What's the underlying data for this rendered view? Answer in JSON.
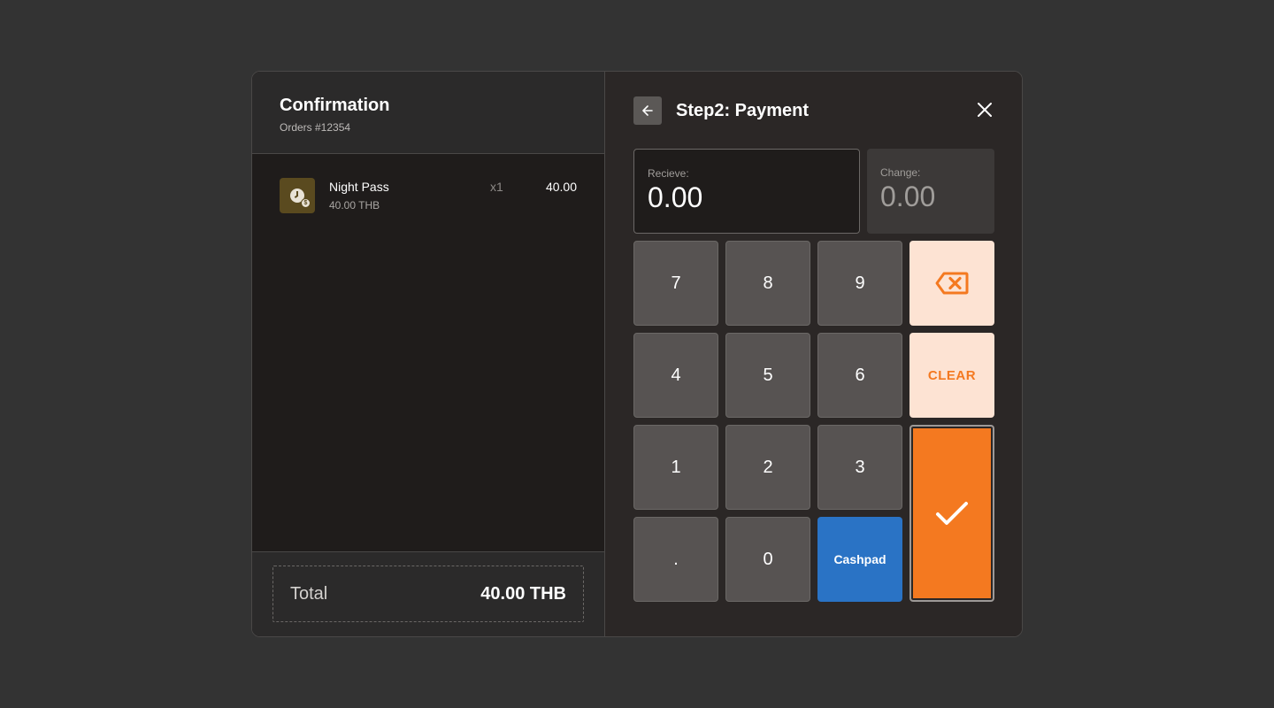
{
  "left": {
    "title": "Confirmation",
    "order": "Orders #12354",
    "items": [
      {
        "name": "Night Pass",
        "unit_price": "40.00 THB",
        "qty": "x1",
        "total": "40.00",
        "icon": "night-pass-clock-coin-icon"
      }
    ],
    "footer": {
      "label": "Total",
      "value": "40.00 THB"
    }
  },
  "right": {
    "title": "Step2: Payment",
    "receive": {
      "label": "Recieve:",
      "value": "0.00"
    },
    "change": {
      "label": "Change:",
      "value": "0.00"
    },
    "keys": {
      "k7": "7",
      "k8": "8",
      "k9": "9",
      "k4": "4",
      "k5": "5",
      "k6": "6",
      "k1": "1",
      "k2": "2",
      "k3": "3",
      "kdot": ".",
      "k0": "0",
      "clear": "CLEAR",
      "cashpad": "Cashpad"
    }
  },
  "colors": {
    "accent": "#f47920",
    "accent_soft": "#fde3d3",
    "cashpad": "#2a73c5",
    "background": "#333333"
  }
}
